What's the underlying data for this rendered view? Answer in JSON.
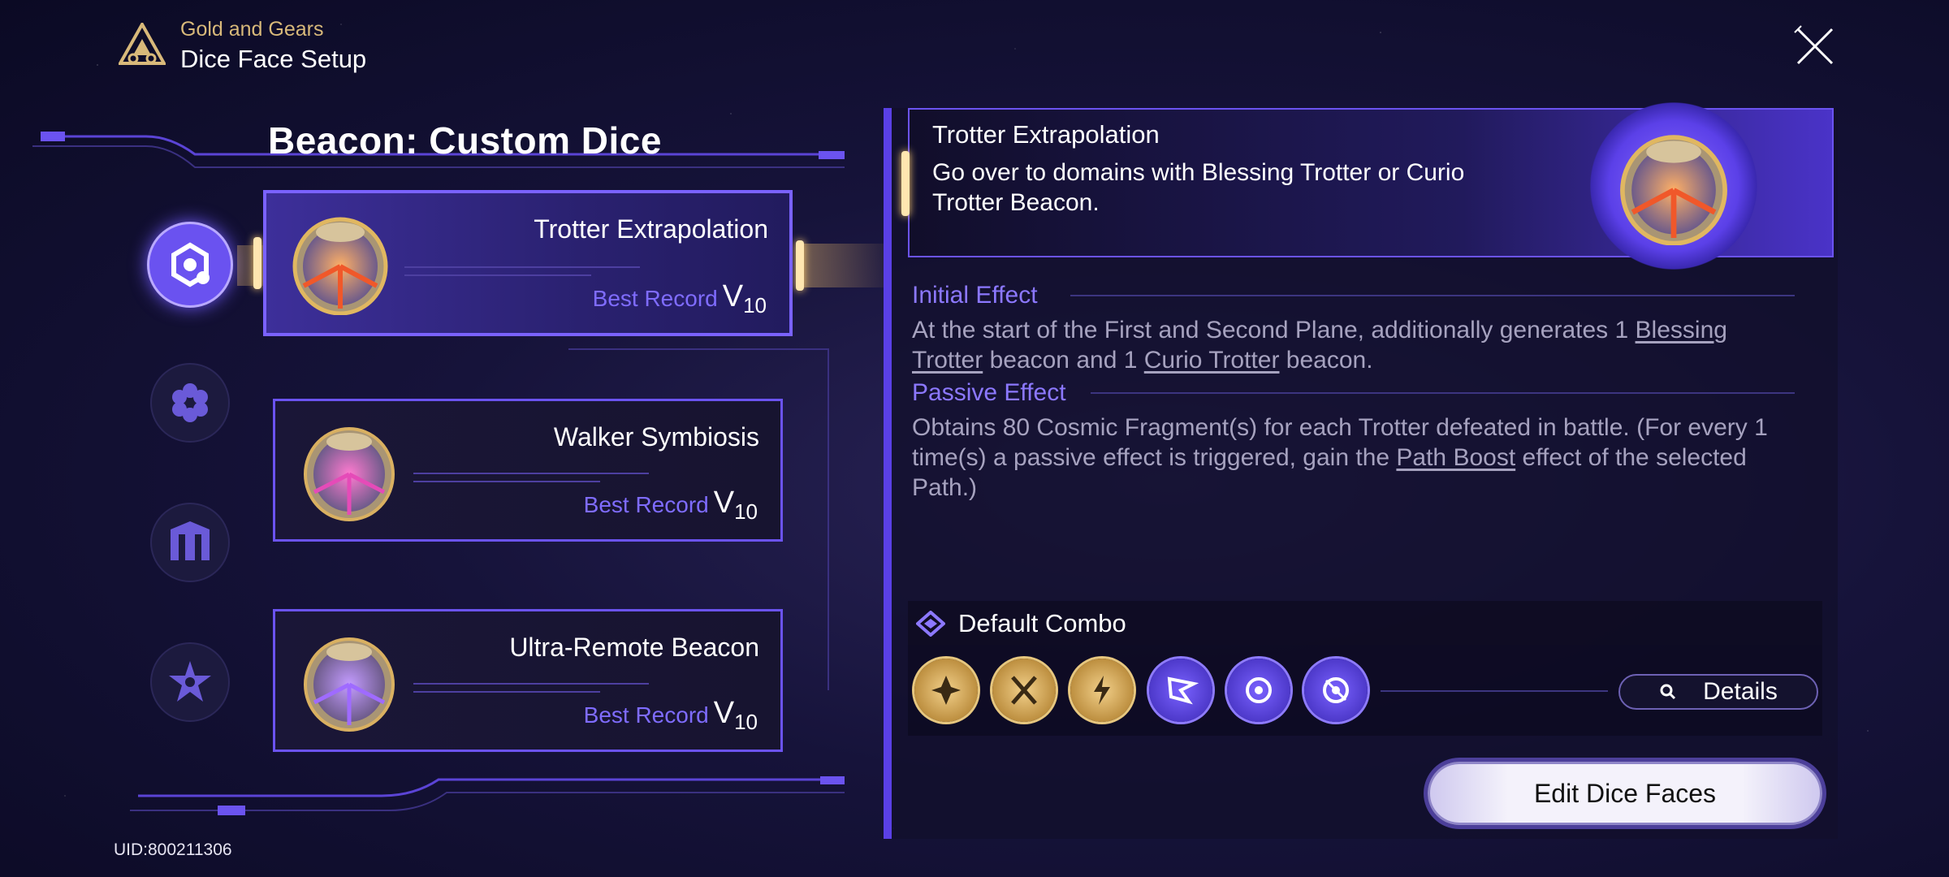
{
  "header": {
    "subtitle": "Gold and Gears",
    "title": "Dice Face Setup"
  },
  "left_panel": {
    "title": "Beacon: Custom Dice",
    "categories": [
      {
        "icon": "beacon-category-icon",
        "active": true
      },
      {
        "icon": "flower-category-icon",
        "active": false
      },
      {
        "icon": "building-category-icon",
        "active": false
      },
      {
        "icon": "star-category-icon",
        "active": false
      }
    ],
    "dice": [
      {
        "name": "Trotter Extrapolation",
        "record_label": "Best Record",
        "level": "V",
        "level_sub": "10",
        "glow": "#f0582a"
      },
      {
        "name": "Walker Symbiosis",
        "record_label": "Best Record",
        "level": "V",
        "level_sub": "10",
        "glow": "#e54bb8"
      },
      {
        "name": "Ultra-Remote Beacon",
        "record_label": "Best Record",
        "level": "V",
        "level_sub": "10",
        "glow": "#9f6bff"
      }
    ]
  },
  "detail": {
    "name": "Trotter Extrapolation",
    "description": "Go over to domains with Blessing Trotter or Curio Trotter Beacon.",
    "initial_effect_title": "Initial Effect",
    "initial_effect_parts": [
      "At the start of the First and Second Plane, additionally generates 1 ",
      "Blessing Trotter",
      " beacon and 1 ",
      "Curio Trotter",
      " beacon."
    ],
    "passive_effect_title": "Passive Effect",
    "passive_effect_parts": [
      "Obtains 80 Cosmic Fragment(s) for each Trotter defeated in battle. (For every 1 time(s) a passive effect is triggered, gain the ",
      "Path Boost",
      " effect of the selected Path.)"
    ],
    "combo_title": "Default Combo",
    "combo_faces": [
      {
        "icon": "shuriken-face-icon",
        "tone": "gold"
      },
      {
        "icon": "crossed-face-icon",
        "tone": "gold"
      },
      {
        "icon": "lightning-face-icon",
        "tone": "gold"
      },
      {
        "icon": "flag-face-icon",
        "tone": "purple"
      },
      {
        "icon": "target-face-icon",
        "tone": "purple"
      },
      {
        "icon": "target-alt-face-icon",
        "tone": "purple"
      }
    ],
    "details_label": "Details",
    "edit_label": "Edit Dice Faces"
  },
  "uid": "UID:800211306",
  "colors": {
    "accent": "#6b53f0",
    "gold": "#d8b97a",
    "link": "#8c78ff"
  }
}
